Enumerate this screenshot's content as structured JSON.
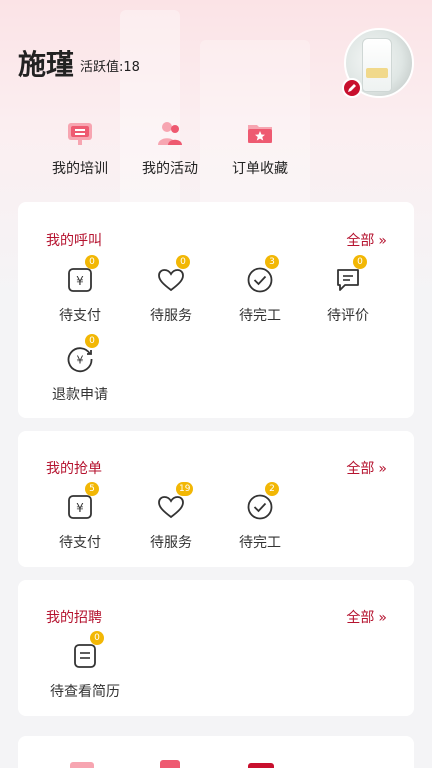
{
  "profile": {
    "name": "施瑾",
    "activity_label": "活跃值:18",
    "avatar_icon": "user-avatar-photo",
    "edit_icon": "pencil-icon"
  },
  "quick_nav": [
    {
      "label": "我的培训",
      "icon": "training-icon"
    },
    {
      "label": "我的活动",
      "icon": "activity-icon"
    },
    {
      "label": "订单收藏",
      "icon": "favorite-order-icon"
    }
  ],
  "calls": {
    "title": "我的呼叫",
    "all_label": "全部",
    "items": [
      {
        "label": "待支付",
        "badge": "0",
        "icon": "yuan-icon"
      },
      {
        "label": "待服务",
        "badge": "0",
        "icon": "heart-icon"
      },
      {
        "label": "待完工",
        "badge": "3",
        "icon": "check-circle-icon"
      },
      {
        "label": "待评价",
        "badge": "0",
        "icon": "comment-icon"
      },
      {
        "label": "退款申请",
        "badge": "0",
        "icon": "refund-icon"
      }
    ]
  },
  "grabs": {
    "title": "我的抢单",
    "all_label": "全部",
    "items": [
      {
        "label": "待支付",
        "badge": "5",
        "icon": "yuan-icon"
      },
      {
        "label": "待服务",
        "badge": "19",
        "icon": "heart-icon"
      },
      {
        "label": "待完工",
        "badge": "2",
        "icon": "check-circle-icon"
      }
    ]
  },
  "recruit": {
    "title": "我的招聘",
    "all_label": "全部",
    "items": [
      {
        "label": "待查看简历",
        "badge": "0",
        "icon": "resume-icon"
      }
    ]
  },
  "colors": {
    "accent": "#b5132f",
    "badge": "#f2b705",
    "icon_pink": "#f06a7e"
  }
}
